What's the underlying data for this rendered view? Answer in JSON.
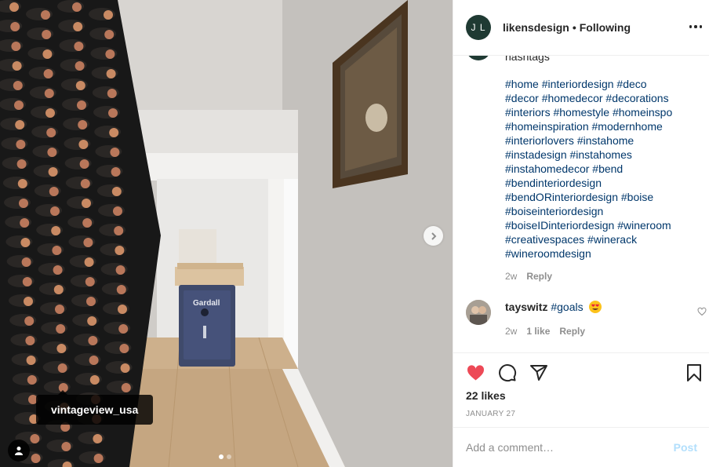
{
  "photo": {
    "tag_username": "vintageview_usa",
    "safe_brand": "Gardall",
    "carousel": {
      "count": 2,
      "active": 1
    }
  },
  "header": {
    "avatar_initials": "J L",
    "username": "likensdesign",
    "separator": "•",
    "follow_status": "Following"
  },
  "caption": {
    "truncated_text": "hashtags",
    "hashtags": [
      "#home #interiordesign #deco",
      "#decor #homedecor #decorations",
      "#interiors #homestyle #homeinspo",
      "#homeinspiration #modernhome",
      "#interiorlovers #instahome",
      "#instadesign #instahomes",
      "#instahomedecor #bend",
      "#bendinteriordesign",
      "#bendORinteriordesign #boise",
      "#boiseinteriordesign",
      "#boiseIDinteriordesign #wineroom",
      "#creativespaces #winerack",
      "#wineroomdesign"
    ],
    "age": "2w",
    "reply_label": "Reply"
  },
  "comment": {
    "username": "tayswitz",
    "text": "#goals",
    "emoji": "heart-eyes-emoji",
    "age": "2w",
    "likes": "1 like",
    "reply_label": "Reply"
  },
  "actions": {
    "liked": true,
    "like_color": "#ed4956",
    "likes_text": "22 likes",
    "date": "JANUARY 27"
  },
  "add_comment": {
    "placeholder": "Add a comment…",
    "post_label": "Post",
    "post_color": "#b2dffc"
  }
}
